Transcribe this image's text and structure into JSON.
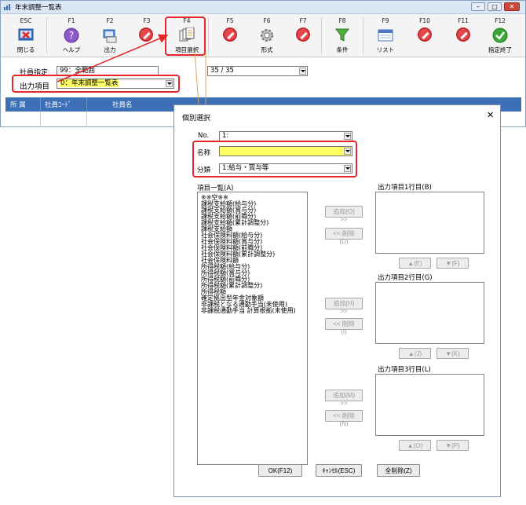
{
  "app": {
    "title": "年末調整一覧表"
  },
  "toolbar": [
    {
      "fk": "ESC",
      "label": "閉じる",
      "icon": "close-window-icon"
    },
    {
      "fk": "F1",
      "label": "ヘルプ",
      "icon": "help-icon"
    },
    {
      "fk": "F2",
      "label": "出力",
      "icon": "print-icon"
    },
    {
      "fk": "F3",
      "label": "",
      "icon": "disabled-icon"
    },
    {
      "fk": "F4",
      "label": "項目選択",
      "icon": "item-select-icon"
    },
    {
      "fk": "F5",
      "label": "",
      "icon": "disabled-icon"
    },
    {
      "fk": "F6",
      "label": "形式",
      "icon": "gear-icon"
    },
    {
      "fk": "F7",
      "label": "",
      "icon": "disabled-icon"
    },
    {
      "fk": "F8",
      "label": "条件",
      "icon": "filter-icon"
    },
    {
      "fk": "F9",
      "label": "リスト",
      "icon": "list-icon"
    },
    {
      "fk": "F10",
      "label": "",
      "icon": "disabled-icon"
    },
    {
      "fk": "F11",
      "label": "",
      "icon": "disabled-icon"
    },
    {
      "fk": "F12",
      "label": "指定終了",
      "icon": "check-icon"
    }
  ],
  "filters": {
    "employee_label": "社員指定",
    "employee_value": "99：全範囲",
    "count_text": "35 / 35",
    "output_label": "出力項目",
    "output_value": "0：年末調整一覧表"
  },
  "grid": {
    "headers": [
      "所 属",
      "社員ｺｰﾄﾞ",
      "社員名"
    ]
  },
  "dialog": {
    "title": "個別選択",
    "no_label": "No.",
    "no_value": "1:",
    "name_label": "名称",
    "name_value": "",
    "category_label": "分類",
    "category_value": "1:給与・賞与等",
    "list_label": "項目一覧(A)",
    "items": [
      "※※空※※",
      "課税支給額(給与分)",
      "課税支給額(賞与分)",
      "課税支給額(前職分)",
      "課税支給額(累計調整分)",
      "課税支給額",
      "社会保険料額(給与分)",
      "社会保険料額(賞与分)",
      "社会保険料額(前職分)",
      "社会保険料額(累計調整分)",
      "社会保険料額",
      "所得税額(給与分)",
      "所得税額(賞与分)",
      "所得税額(前職分)",
      "所得税額(累計調整分)",
      "所得税額",
      "確定拠出型年金対象額",
      "非課税となる通勤手当(未使用)",
      "非課税通勤手当 計算根拠(未使用)"
    ],
    "groups": [
      {
        "label": "出力項目1行目(B)",
        "add": "追加(O) >>",
        "remove": "<< 削除(D)",
        "up": "▲(E)",
        "down": "▼(F)"
      },
      {
        "label": "出力項目2行目(G)",
        "add": "追加(H) >>",
        "remove": "<< 削除(I)",
        "up": "▲(J)",
        "down": "▼(K)"
      },
      {
        "label": "出力項目3行目(L)",
        "add": "追加(M) >>",
        "remove": "<< 削除(N)",
        "up": "▲(O)",
        "down": "▼(P)"
      }
    ],
    "ok_label": "OK(F12)",
    "cancel_label": "ｷｬﾝｾﾙ(ESC)",
    "clear_label": "全削除(Z)",
    "close_glyph": "✕"
  },
  "colors": {
    "accent_red": "#e5272b",
    "grid_header": "#3d6fb6",
    "name_field": "#ffff66"
  }
}
